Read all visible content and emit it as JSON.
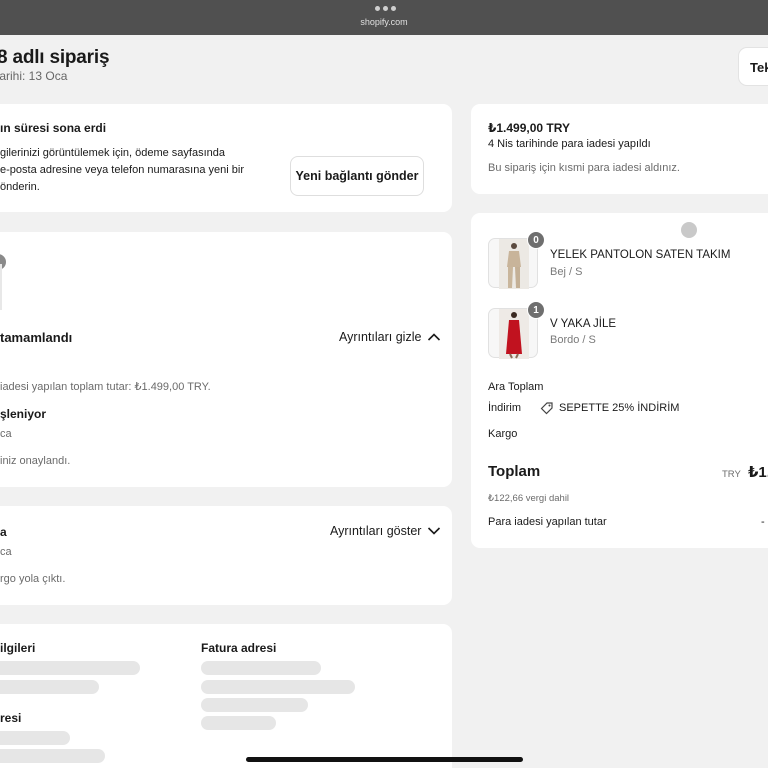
{
  "browser": {
    "url": "shopify.com"
  },
  "header": {
    "title": "8 adlı sipariş",
    "date": "tarihi: 13 Oca",
    "right_button": "Tek"
  },
  "link_expired": {
    "title": "ın süresi sona erdi",
    "body_line1": "gilerinizi görüntülemek için, ödeme sayfasında",
    "body_line2": "e-posta adresine veya telefon numarasına yeni bir",
    "body_line3": "önderin.",
    "button": "Yeni bağlantı gönder"
  },
  "refund_status": {
    "title": "tamamlandı",
    "toggle": "Ayrıntıları gizle",
    "amount_line": "iadesi yapılan toplam tutar: ₺1.499,00 TRY.",
    "processing_title": "şleniyor",
    "processing_date": "ca",
    "confirmed": "iniz onaylandı."
  },
  "shipping_status": {
    "title": "a",
    "date": "ca",
    "toggle": "Ayrıntıları göster",
    "message": "rgo yola çıktı."
  },
  "info": {
    "contact_title": "ilgileri",
    "billing_title": "Fatura adresi",
    "address_title": "resi"
  },
  "refund_summary": {
    "amount": "₺1.499,00 TRY",
    "date_text": "4 Nis tarihinde para iadesi yapıldı",
    "note": "Bu sipariş için kısmi para iadesi aldınız."
  },
  "order_items": [
    {
      "name": "YELEK PANTOLON SATEN TAKIM",
      "variant": "Bej / S",
      "quantity": "0"
    },
    {
      "name": "V YAKA JİLE",
      "variant": "Bordo / S",
      "quantity": "1"
    }
  ],
  "summary": {
    "subtotal_label": "Ara Toplam",
    "discount_label": "İndirim",
    "discount_code": "SEPETTE 25% İNDİRİM",
    "shipping_label": "Kargo",
    "total_label": "Toplam",
    "currency": "TRY",
    "total_value": "₺1.",
    "tax_note": "₺122,66 vergi dahil",
    "refunded_label": "Para iadesi yapılan tutar",
    "refunded_value": "-"
  }
}
